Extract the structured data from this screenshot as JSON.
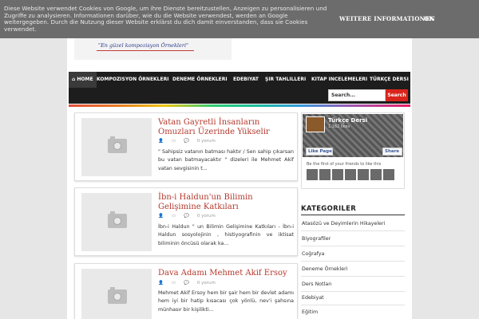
{
  "cookie": {
    "text": "Diese Website verwendet Cookies von Google, um ihre Dienste bereitzustellen, Anzeigen zu personalisieren und Zugriffe zu analysieren. Informationen darüber, wie du die Website verwendest, werden an Google weitergegeben. Durch die Nutzung dieser Website erklärst du dich damit einverstanden, dass sie Cookies verwendet.",
    "more_label": "WEITERE INFORMATIONEN",
    "ok_label": "OK"
  },
  "logo": {
    "tagline": "\"En güzel kompozisyon Örnekleri\""
  },
  "nav": {
    "items": [
      {
        "label": "⌂ HOME"
      },
      {
        "label": "KOMPOZISYON ÖRNEKLERI"
      },
      {
        "label": "DENEME ÖRNEKLERI"
      },
      {
        "label": "EDEBIYAT"
      },
      {
        "label": "ŞIR TAHLILLERI"
      },
      {
        "label": "KITAP INCELEMELERI"
      },
      {
        "label": "TÜRKÇE DERSI"
      }
    ]
  },
  "search": {
    "placeholder": "Search...",
    "button_label": "Search"
  },
  "posts": [
    {
      "title": "Vatan Gayretli İnsanların Omuzları Üzerinde Yükselir",
      "comments": "0 yorum",
      "excerpt": "\" Sahipsiz vatanın batması haktır / Sen sahip çıkarsan bu vatan batmayacaktır \" dizeleri ile Mehmet Akif vatan sevgisinin t..."
    },
    {
      "title": "İbn-i Haldun'un Bilimin Gelişimine Katkıları",
      "comments": "0 yorum",
      "excerpt": "İbn-i Haldun \" un Bilimin Gelişimine Katkıları - İbn-i Haldun sosyolojinin , histiyografinin ve iktisat biliminin öncüsü olarak ka..."
    },
    {
      "title": "Dava Adamı Mehmet Akif Ersoy",
      "comments": "0 yorum",
      "excerpt": "Mehmet Akif Ersoy hem bir şair hem bir devlet adamı hem iyi bir hatip kısacası çok yönlü, nev'i şahsına münhasır bir kişilikti..."
    }
  ],
  "facebook": {
    "page_name": "Türkçe Dersi",
    "likes": "1.162 likes",
    "like_label": "Like Page",
    "share_label": "Share",
    "first_text": "Be the first of your friends to like this"
  },
  "categories": {
    "title": "KATEGORILER",
    "items": [
      "Atasözü ve Deyimlerin Hikayeleri",
      "Biyografiler",
      "Coğrafya",
      "Deneme Örnekleri",
      "Ders Notları",
      "Edebiyat",
      "Eğitim"
    ]
  }
}
